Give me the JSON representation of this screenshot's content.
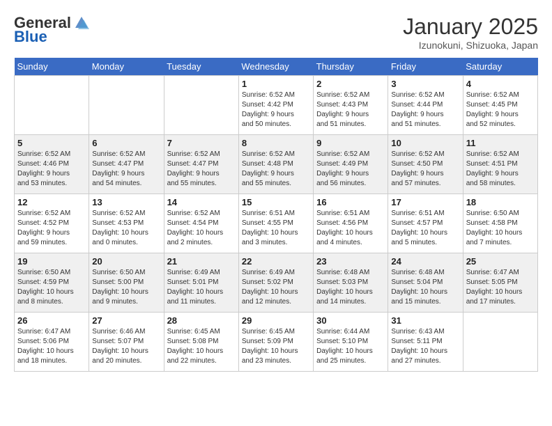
{
  "header": {
    "logo_general": "General",
    "logo_blue": "Blue",
    "month_year": "January 2025",
    "location": "Izunokuni, Shizuoka, Japan"
  },
  "days_of_week": [
    "Sunday",
    "Monday",
    "Tuesday",
    "Wednesday",
    "Thursday",
    "Friday",
    "Saturday"
  ],
  "weeks": [
    [
      {
        "day": "",
        "info": ""
      },
      {
        "day": "",
        "info": ""
      },
      {
        "day": "",
        "info": ""
      },
      {
        "day": "1",
        "info": "Sunrise: 6:52 AM\nSunset: 4:42 PM\nDaylight: 9 hours\nand 50 minutes."
      },
      {
        "day": "2",
        "info": "Sunrise: 6:52 AM\nSunset: 4:43 PM\nDaylight: 9 hours\nand 51 minutes."
      },
      {
        "day": "3",
        "info": "Sunrise: 6:52 AM\nSunset: 4:44 PM\nDaylight: 9 hours\nand 51 minutes."
      },
      {
        "day": "4",
        "info": "Sunrise: 6:52 AM\nSunset: 4:45 PM\nDaylight: 9 hours\nand 52 minutes."
      }
    ],
    [
      {
        "day": "5",
        "info": "Sunrise: 6:52 AM\nSunset: 4:46 PM\nDaylight: 9 hours\nand 53 minutes."
      },
      {
        "day": "6",
        "info": "Sunrise: 6:52 AM\nSunset: 4:47 PM\nDaylight: 9 hours\nand 54 minutes."
      },
      {
        "day": "7",
        "info": "Sunrise: 6:52 AM\nSunset: 4:47 PM\nDaylight: 9 hours\nand 55 minutes."
      },
      {
        "day": "8",
        "info": "Sunrise: 6:52 AM\nSunset: 4:48 PM\nDaylight: 9 hours\nand 55 minutes."
      },
      {
        "day": "9",
        "info": "Sunrise: 6:52 AM\nSunset: 4:49 PM\nDaylight: 9 hours\nand 56 minutes."
      },
      {
        "day": "10",
        "info": "Sunrise: 6:52 AM\nSunset: 4:50 PM\nDaylight: 9 hours\nand 57 minutes."
      },
      {
        "day": "11",
        "info": "Sunrise: 6:52 AM\nSunset: 4:51 PM\nDaylight: 9 hours\nand 58 minutes."
      }
    ],
    [
      {
        "day": "12",
        "info": "Sunrise: 6:52 AM\nSunset: 4:52 PM\nDaylight: 9 hours\nand 59 minutes."
      },
      {
        "day": "13",
        "info": "Sunrise: 6:52 AM\nSunset: 4:53 PM\nDaylight: 10 hours\nand 0 minutes."
      },
      {
        "day": "14",
        "info": "Sunrise: 6:52 AM\nSunset: 4:54 PM\nDaylight: 10 hours\nand 2 minutes."
      },
      {
        "day": "15",
        "info": "Sunrise: 6:51 AM\nSunset: 4:55 PM\nDaylight: 10 hours\nand 3 minutes."
      },
      {
        "day": "16",
        "info": "Sunrise: 6:51 AM\nSunset: 4:56 PM\nDaylight: 10 hours\nand 4 minutes."
      },
      {
        "day": "17",
        "info": "Sunrise: 6:51 AM\nSunset: 4:57 PM\nDaylight: 10 hours\nand 5 minutes."
      },
      {
        "day": "18",
        "info": "Sunrise: 6:50 AM\nSunset: 4:58 PM\nDaylight: 10 hours\nand 7 minutes."
      }
    ],
    [
      {
        "day": "19",
        "info": "Sunrise: 6:50 AM\nSunset: 4:59 PM\nDaylight: 10 hours\nand 8 minutes."
      },
      {
        "day": "20",
        "info": "Sunrise: 6:50 AM\nSunset: 5:00 PM\nDaylight: 10 hours\nand 9 minutes."
      },
      {
        "day": "21",
        "info": "Sunrise: 6:49 AM\nSunset: 5:01 PM\nDaylight: 10 hours\nand 11 minutes."
      },
      {
        "day": "22",
        "info": "Sunrise: 6:49 AM\nSunset: 5:02 PM\nDaylight: 10 hours\nand 12 minutes."
      },
      {
        "day": "23",
        "info": "Sunrise: 6:48 AM\nSunset: 5:03 PM\nDaylight: 10 hours\nand 14 minutes."
      },
      {
        "day": "24",
        "info": "Sunrise: 6:48 AM\nSunset: 5:04 PM\nDaylight: 10 hours\nand 15 minutes."
      },
      {
        "day": "25",
        "info": "Sunrise: 6:47 AM\nSunset: 5:05 PM\nDaylight: 10 hours\nand 17 minutes."
      }
    ],
    [
      {
        "day": "26",
        "info": "Sunrise: 6:47 AM\nSunset: 5:06 PM\nDaylight: 10 hours\nand 18 minutes."
      },
      {
        "day": "27",
        "info": "Sunrise: 6:46 AM\nSunset: 5:07 PM\nDaylight: 10 hours\nand 20 minutes."
      },
      {
        "day": "28",
        "info": "Sunrise: 6:45 AM\nSunset: 5:08 PM\nDaylight: 10 hours\nand 22 minutes."
      },
      {
        "day": "29",
        "info": "Sunrise: 6:45 AM\nSunset: 5:09 PM\nDaylight: 10 hours\nand 23 minutes."
      },
      {
        "day": "30",
        "info": "Sunrise: 6:44 AM\nSunset: 5:10 PM\nDaylight: 10 hours\nand 25 minutes."
      },
      {
        "day": "31",
        "info": "Sunrise: 6:43 AM\nSunset: 5:11 PM\nDaylight: 10 hours\nand 27 minutes."
      },
      {
        "day": "",
        "info": ""
      }
    ]
  ]
}
